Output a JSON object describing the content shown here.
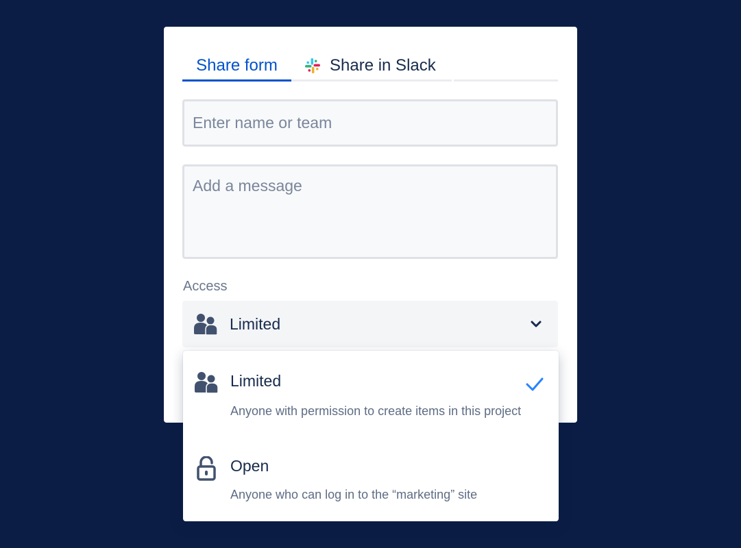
{
  "tabs": {
    "share_form": "Share form",
    "share_in_slack": "Share in Slack"
  },
  "form": {
    "name_placeholder": "Enter name or team",
    "message_placeholder": "Add a message",
    "access_label": "Access"
  },
  "access_select": {
    "value": "Limited",
    "icon": "people-icon"
  },
  "access_options": [
    {
      "title": "Limited",
      "description": "Anyone with permission to create items in this project",
      "icon": "people-icon",
      "selected": true
    },
    {
      "title": "Open",
      "description": "Anyone who can log in to the “marketing” site",
      "icon": "unlock-icon",
      "selected": false
    }
  ],
  "colors": {
    "background": "#0b1d45",
    "accent": "#0052cc",
    "check": "#2684ff",
    "text": "#172b4d",
    "muted_text": "#5e6c84"
  }
}
